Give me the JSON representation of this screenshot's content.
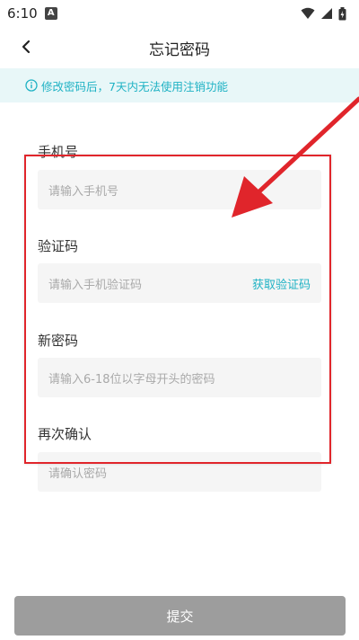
{
  "status_bar": {
    "time": "6:10",
    "notification_icon": "A"
  },
  "header": {
    "title": "忘记密码",
    "back_icon": "chevron-left-icon"
  },
  "notice": {
    "text": "修改密码后，7天内无法使用注销功能",
    "icon": "info-icon"
  },
  "form": {
    "phone": {
      "label": "手机号",
      "placeholder": "请输入手机号"
    },
    "code": {
      "label": "验证码",
      "placeholder": "请输入手机验证码",
      "action": "获取验证码"
    },
    "new_password": {
      "label": "新密码",
      "placeholder": "请输入6-18位以字母开头的密码"
    },
    "confirm_password": {
      "label": "再次确认",
      "placeholder": "请确认密码"
    }
  },
  "submit": {
    "label": "提交"
  },
  "colors": {
    "accent": "#1fb2c4",
    "annotation": "#e0252b",
    "button": "#9d9d9d"
  }
}
